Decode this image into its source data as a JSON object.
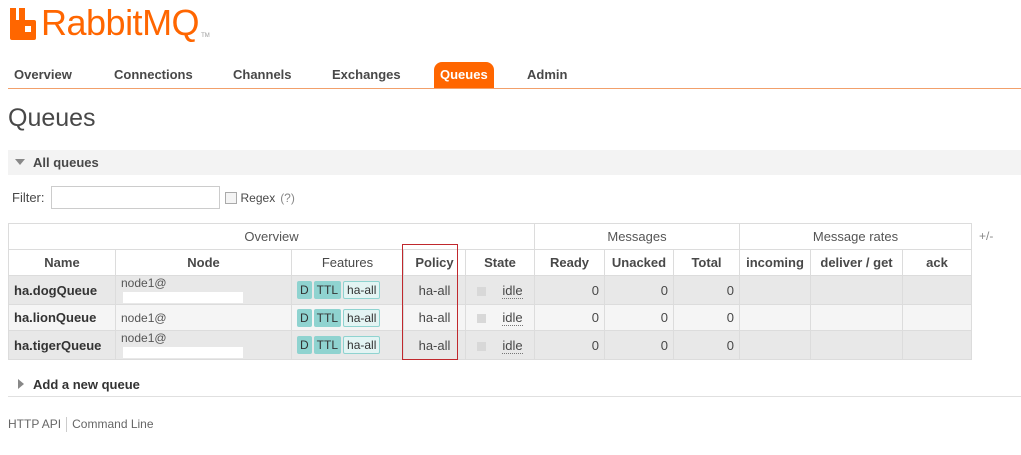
{
  "logo": {
    "text": "RabbitMQ",
    "tm": "TM"
  },
  "nav": [
    "Overview",
    "Connections",
    "Channels",
    "Exchanges",
    "Queues",
    "Admin"
  ],
  "page_title": "Queues",
  "section": {
    "title": "All queues"
  },
  "filter": {
    "label": "Filter:",
    "value": "",
    "regex_label": "Regex",
    "help": "(?)"
  },
  "table": {
    "groups": [
      "Overview",
      "Messages",
      "Message rates"
    ],
    "columns": [
      "Name",
      "Node",
      "Features",
      "Policy",
      "State",
      "Ready",
      "Unacked",
      "Total",
      "incoming",
      "deliver / get",
      "ack"
    ],
    "plus_minus": "+/-",
    "rows": [
      {
        "name": "ha.dogQueue",
        "node": "node1@",
        "feature_d": "D",
        "feature_ttl": "TTL",
        "feature_policy": "ha-all",
        "policy": "ha-all",
        "state": "idle",
        "ready": "0",
        "unacked": "0",
        "total": "0",
        "incoming": "",
        "deliver_get": "",
        "ack": ""
      },
      {
        "name": "ha.lionQueue",
        "node": "node1@",
        "feature_d": "D",
        "feature_ttl": "TTL",
        "feature_policy": "ha-all",
        "policy": "ha-all",
        "state": "idle",
        "ready": "0",
        "unacked": "0",
        "total": "0",
        "incoming": "",
        "deliver_get": "",
        "ack": ""
      },
      {
        "name": "ha.tigerQueue",
        "node": "node1@",
        "feature_d": "D",
        "feature_ttl": "TTL",
        "feature_policy": "ha-all",
        "policy": "ha-all",
        "state": "idle",
        "ready": "0",
        "unacked": "0",
        "total": "0",
        "incoming": "",
        "deliver_get": "",
        "ack": ""
      }
    ]
  },
  "add_queue": "Add a new queue",
  "footer": [
    "HTTP API",
    "Command Line"
  ],
  "colors": {
    "brand": "#ff6600",
    "highlight_box": "#c0282d",
    "feature_tag": "#8fd3d0"
  }
}
